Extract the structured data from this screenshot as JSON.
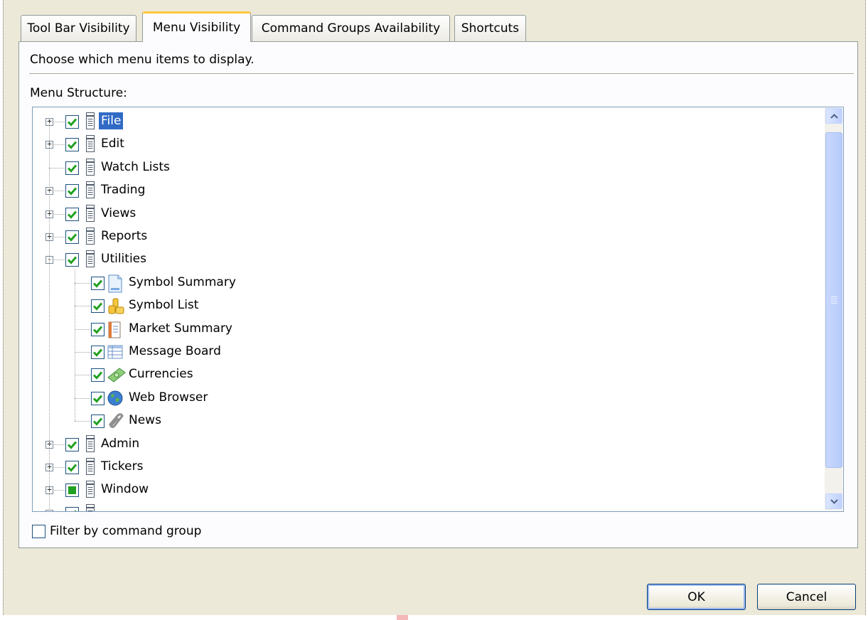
{
  "tabs": [
    {
      "label": "Tool Bar Visibility",
      "active": false
    },
    {
      "label": "Menu Visibility",
      "active": true
    },
    {
      "label": "Command Groups Availability",
      "active": false
    },
    {
      "label": "Shortcuts",
      "active": false
    }
  ],
  "panel": {
    "hint": "Choose which menu items to display.",
    "structure_label": "Menu Structure:"
  },
  "tree": {
    "items": [
      {
        "label": "File",
        "expander": "+",
        "check": "checked",
        "icon": "menu-page-icon",
        "selected": true
      },
      {
        "label": "Edit",
        "expander": "+",
        "check": "checked",
        "icon": "menu-page-icon"
      },
      {
        "label": "Watch Lists",
        "expander": "",
        "check": "checked",
        "icon": "menu-page-icon"
      },
      {
        "label": "Trading",
        "expander": "+",
        "check": "checked",
        "icon": "menu-page-icon"
      },
      {
        "label": "Views",
        "expander": "+",
        "check": "checked",
        "icon": "menu-page-icon"
      },
      {
        "label": "Reports",
        "expander": "+",
        "check": "checked",
        "icon": "menu-page-icon"
      },
      {
        "label": "Utilities",
        "expander": "-",
        "check": "checked",
        "icon": "menu-page-icon",
        "expanded": true
      },
      {
        "label": "Symbol Summary",
        "child": true,
        "check": "checked",
        "icon": "document-icon"
      },
      {
        "label": "Symbol List",
        "child": true,
        "check": "checked",
        "icon": "coins-icon"
      },
      {
        "label": "Market Summary",
        "child": true,
        "check": "checked",
        "icon": "notepad-icon"
      },
      {
        "label": "Message Board",
        "child": true,
        "check": "checked",
        "icon": "table-icon"
      },
      {
        "label": "Currencies",
        "child": true,
        "check": "checked",
        "icon": "banknote-icon"
      },
      {
        "label": "Web Browser",
        "child": true,
        "check": "checked",
        "icon": "globe-icon"
      },
      {
        "label": "News",
        "child": true,
        "check": "checked",
        "icon": "paperclip-icon"
      },
      {
        "label": "Admin",
        "expander": "+",
        "check": "checked",
        "icon": "menu-page-icon"
      },
      {
        "label": "Tickers",
        "expander": "+",
        "check": "checked",
        "icon": "menu-page-icon"
      },
      {
        "label": "Window",
        "expander": "+",
        "check": "partial",
        "icon": "menu-page-icon"
      },
      {
        "label": "",
        "expander": "+",
        "check": "checked",
        "icon": "menu-page-icon"
      }
    ]
  },
  "filter": {
    "label": "Filter by command group",
    "checked": false
  },
  "buttons": {
    "ok": "OK",
    "cancel": "Cancel"
  },
  "colors": {
    "selection": "#316ac5",
    "check": "#21a121",
    "dialog_bg": "#ece9d8",
    "active_tab_accent": "#ffc83c"
  }
}
